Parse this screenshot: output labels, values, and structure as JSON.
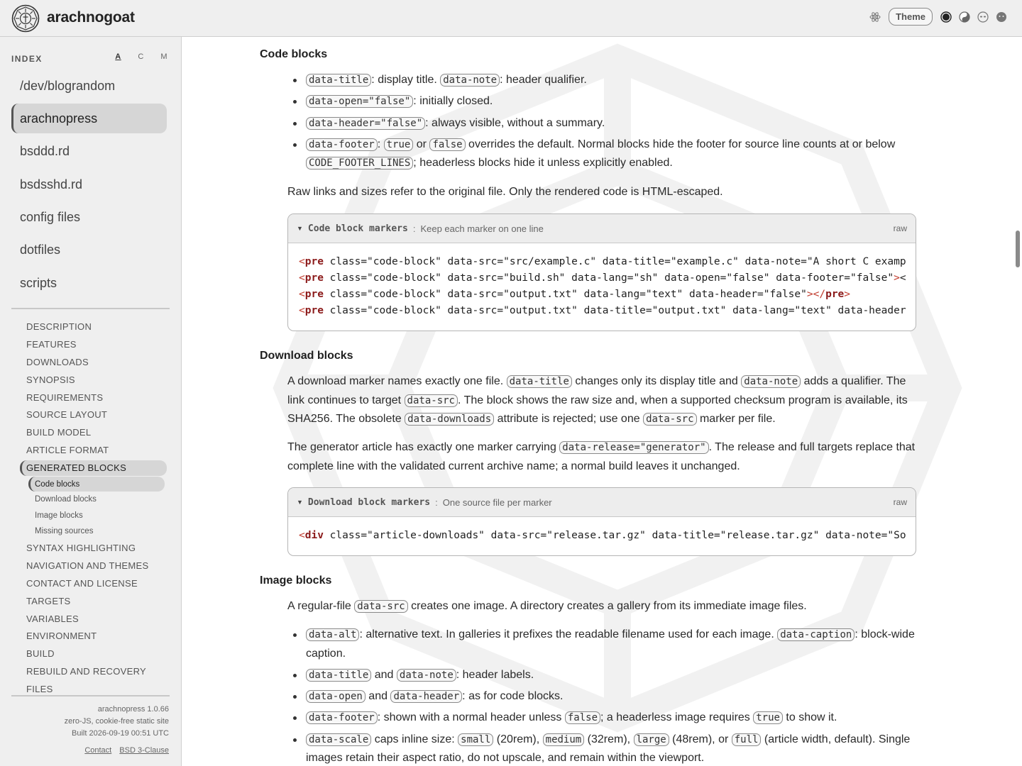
{
  "header": {
    "site_name": "arachnogoat",
    "theme_label": "Theme",
    "icons": [
      "atom-icon",
      "dark-theme-icon",
      "yin-yang-theme-icon",
      "alien-theme-icon",
      "face-theme-icon"
    ]
  },
  "sidebar": {
    "index_label": "INDEX",
    "sort": [
      "A",
      "C",
      "M"
    ],
    "projects": [
      "/dev/blograndom",
      "arachnopress",
      "bsddd.rd",
      "bsdsshd.rd",
      "config files",
      "dotfiles",
      "scripts"
    ],
    "active_project": "arachnopress",
    "toc": [
      {
        "label": "DESCRIPTION"
      },
      {
        "label": "FEATURES"
      },
      {
        "label": "DOWNLOADS"
      },
      {
        "label": "SYNOPSIS"
      },
      {
        "label": "REQUIREMENTS"
      },
      {
        "label": "SOURCE LAYOUT"
      },
      {
        "label": "BUILD MODEL"
      },
      {
        "label": "ARTICLE FORMAT"
      },
      {
        "label": "GENERATED BLOCKS",
        "active": true,
        "children": [
          "Code blocks",
          "Download blocks",
          "Image blocks",
          "Missing sources"
        ]
      },
      {
        "label": "SYNTAX HIGHLIGHTING"
      },
      {
        "label": "NAVIGATION AND THEMES"
      },
      {
        "label": "CONTACT AND LICENSE"
      },
      {
        "label": "TARGETS"
      },
      {
        "label": "VARIABLES"
      },
      {
        "label": "ENVIRONMENT"
      },
      {
        "label": "BUILD"
      },
      {
        "label": "REBUILD AND RECOVERY"
      },
      {
        "label": "FILES"
      }
    ],
    "active_sub": "Code blocks",
    "footer": {
      "version": "arachnopress 1.0.66",
      "tagline": "zero-JS, cookie-free static site",
      "built": "Built 2026-09-19 00:51 UTC",
      "contact": "Contact",
      "license": "BSD 3-Clause"
    }
  },
  "main": {
    "code_blocks": {
      "heading": "Code blocks",
      "items": [
        {
          "c1": "data-title",
          "t1": ": display title. ",
          "c2": "data-note",
          "t2": ": header qualifier."
        },
        {
          "c1": "data-open=\"false\"",
          "t1": ": initially closed."
        },
        {
          "c1": "data-header=\"false\"",
          "t1": ": always visible, without a summary."
        },
        {
          "c1": "data-footer",
          "t1": ": ",
          "c2": "true",
          "t2": " or ",
          "c3": "false",
          "t3": " overrides the default. Normal blocks hide the footer for source line counts at or below ",
          "c4": "CODE_FOOTER_LINES",
          "t4": "; headerless blocks hide it unless explicitly enabled."
        }
      ],
      "note": "Raw links and sizes refer to the original file. Only the rendered code is HTML-escaped.",
      "box": {
        "title": "Code block markers",
        "subtitle": "Keep each marker on one line",
        "raw": "raw",
        "lines": [
          "<pre class=\"code-block\" data-src=\"src/example.c\" data-title=\"example.c\" data-note=\"A short C examp",
          "<pre class=\"code-block\" data-src=\"build.sh\" data-lang=\"sh\" data-open=\"false\" data-footer=\"false\"><",
          "<pre class=\"code-block\" data-src=\"output.txt\" data-lang=\"text\" data-header=\"false\"></pre>",
          "<pre class=\"code-block\" data-src=\"output.txt\" data-title=\"output.txt\" data-lang=\"text\" data-header"
        ]
      }
    },
    "download_blocks": {
      "heading": "Download blocks",
      "p1": {
        "t0": "A download marker names exactly one file. ",
        "c1": "data-title",
        "t1": " changes only its display title and ",
        "c2": "data-note",
        "t2": " adds a qualifier. The link continues to target ",
        "c3": "data-src",
        "t3": ". The block shows the raw size and, when a supported checksum program is available, its SHA256. The obsolete ",
        "c4": "data-downloads",
        "t4": " attribute is rejected; use one ",
        "c5": "data-src",
        "t5": " marker per file."
      },
      "p2": {
        "t0": "The generator article has exactly one marker carrying ",
        "c1": "data-release=\"generator\"",
        "t1": ". The release and full targets replace that complete line with the validated current archive name; a normal build leaves it unchanged."
      },
      "box": {
        "title": "Download block markers",
        "subtitle": "One source file per marker",
        "raw": "raw",
        "lines": [
          "<div class=\"article-downloads\" data-src=\"release.tar.gz\" data-title=\"release.tar.gz\" data-note=\"So"
        ]
      }
    },
    "image_blocks": {
      "heading": "Image blocks",
      "p1": {
        "t0": "A regular-file ",
        "c1": "data-src",
        "t1": " creates one image. A directory creates a gallery from its immediate image files."
      },
      "items": [
        {
          "c1": "data-alt",
          "t1": ": alternative text. In galleries it prefixes the readable filename used for each image. ",
          "c2": "data-caption",
          "t2": ": block-wide caption."
        },
        {
          "c1": "data-title",
          "t1": " and ",
          "c2": "data-note",
          "t2": ": header labels."
        },
        {
          "c1": "data-open",
          "t1": " and ",
          "c2": "data-header",
          "t2": ": as for code blocks."
        },
        {
          "c1": "data-footer",
          "t1": ": shown with a normal header unless ",
          "c2": "false",
          "t2": "; a headerless image requires ",
          "c3": "true",
          "t3": " to show it."
        },
        {
          "c1": "data-scale",
          "t1": " caps inline size: ",
          "c2": "small",
          "t2": " (20rem), ",
          "c3": "medium",
          "t3": " (32rem), ",
          "c4": "large",
          "t4": " (48rem), or ",
          "c5": "full",
          "t5": " (article width, default). Single images retain their aspect ratio, do not upscale, and remain within the viewport."
        }
      ]
    }
  }
}
